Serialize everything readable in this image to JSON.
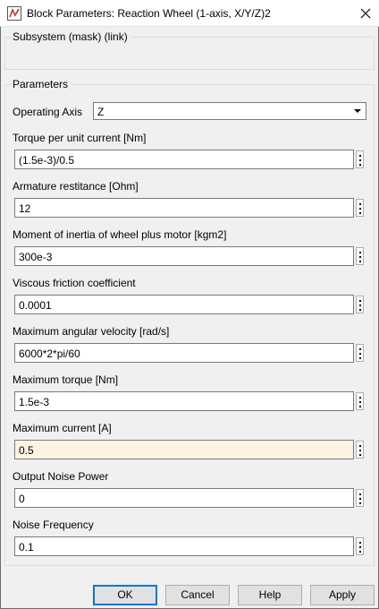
{
  "window": {
    "title": "Block Parameters: Reaction Wheel (1-axis, X/Y/Z)2"
  },
  "subsystem": {
    "label": "Subsystem (mask) (link)"
  },
  "parameters": {
    "group_label": "Parameters",
    "operating_axis": {
      "label": "Operating Axis",
      "value": "Z"
    },
    "fields": [
      {
        "label": "Torque per unit current [Nm]",
        "value": "(1.5e-3)/0.5"
      },
      {
        "label": "Armature restitance [Ohm]",
        "value": "12"
      },
      {
        "label": "Moment of inertia of wheel plus motor [kgm2]",
        "value": "300e-3"
      },
      {
        "label": "Viscous friction coefficient",
        "value": "0.0001"
      },
      {
        "label": "Maximum angular velocity [rad/s]",
        "value": "6000*2*pi/60"
      },
      {
        "label": "Maximum torque [Nm]",
        "value": "1.5e-3"
      },
      {
        "label": "Maximum current [A]",
        "value": "0.5"
      },
      {
        "label": "Output Noise Power",
        "value": "0"
      },
      {
        "label": "Noise Frequency",
        "value": "0.1"
      }
    ]
  },
  "buttons": {
    "ok": "OK",
    "cancel": "Cancel",
    "help": "Help",
    "apply": "Apply"
  },
  "colors": {
    "accent": "#0078d7",
    "highlight_field": "#fdf3e3"
  }
}
